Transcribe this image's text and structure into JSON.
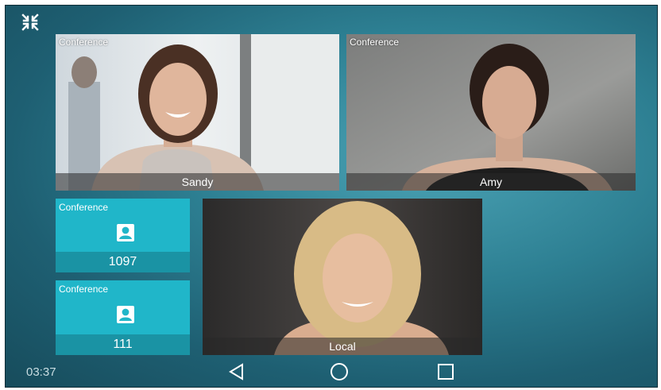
{
  "status_bar": {
    "time": "03:37"
  },
  "tiles": {
    "sandy": {
      "tag": "Conference",
      "name": "Sandy"
    },
    "amy": {
      "tag": "Conference",
      "name": "Amy"
    },
    "audio_1097": {
      "tag": "Conference",
      "number": "1097"
    },
    "audio_111": {
      "tag": "Conference",
      "number": "111"
    },
    "local": {
      "name": "Local"
    }
  },
  "icons": {
    "exit_fullscreen": "exit-fullscreen-icon",
    "back": "triangle-back-icon",
    "home": "circle-home-icon",
    "recents": "square-recents-icon",
    "avatar": "contact-avatar-icon"
  }
}
